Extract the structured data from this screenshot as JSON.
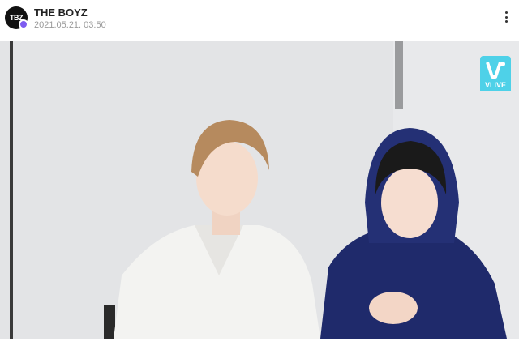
{
  "header": {
    "avatar_label": "TBZ",
    "channel_name": "THE BOYZ",
    "timestamp": "2021.05.21. 03:50"
  },
  "video": {
    "logo_text": "VLIVE"
  },
  "colors": {
    "brand_cyan": "#4ed1e8",
    "badge_purple": "#7d5cf0"
  },
  "icons": [
    "more-vertical-icon",
    "vlive-logo-icon",
    "channel-badge-icon"
  ]
}
